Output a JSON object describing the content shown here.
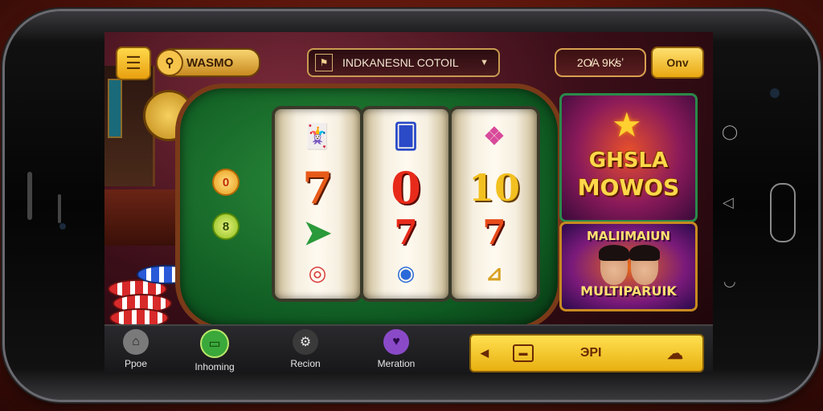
{
  "header": {
    "brand_label": "WASMO",
    "region_label": "INDKANESNL COTOIL",
    "balance_label": "2O̸A 9K̸sʼ",
    "on_button_label": "Onv"
  },
  "reels": [
    {
      "top": "🃏",
      "mid": "7",
      "mid2": "➤",
      "bot": "◎"
    },
    {
      "top": "🂠",
      "mid": "0",
      "mid2": "7",
      "bot": "◉"
    },
    {
      "top": "❖",
      "mid": "10",
      "mid2": "7",
      "bot": "⊿"
    }
  ],
  "lamps": [
    "0",
    "8"
  ],
  "promo_top": {
    "line1": "GHSLA",
    "line2": "MOWOS"
  },
  "promo_bottom": {
    "line1": "MALIIMAIUN",
    "line2": "MULTIPARUIK"
  },
  "bottom_nav": [
    {
      "label": "Ppoe",
      "icon": "home-icon",
      "color": "#7a7a7a"
    },
    {
      "label": "Inhoming",
      "icon": "chat-icon",
      "color": "#3aa83a"
    },
    {
      "label": "Recion",
      "icon": "gear-icon",
      "color": "#5a5a5a"
    },
    {
      "label": "Meration",
      "icon": "heart-icon",
      "color": "#8a4ac8"
    }
  ],
  "action_bar": {
    "text": "ЭPI"
  },
  "colors": {
    "accent": "#f2c230",
    "board_green": "#1a7a2e",
    "frame": "#7a3a18"
  }
}
